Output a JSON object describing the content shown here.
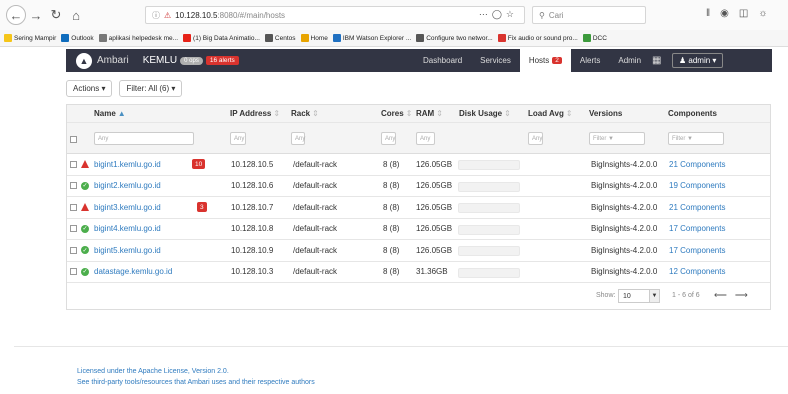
{
  "browser": {
    "url_host": "10.128.10.5",
    "url_path": ":8080/#/main/hosts",
    "search_placeholder": "Cari",
    "bookmarks": [
      {
        "label": "Sering Mampir",
        "color": "#f5c518"
      },
      {
        "label": "Outlook",
        "color": "#0f6cbd"
      },
      {
        "label": "aplikasi helpedesk me...",
        "color": "#777777"
      },
      {
        "label": "(1) Big Data Animatio...",
        "color": "#e62117"
      },
      {
        "label": "Centos",
        "color": "#555555"
      },
      {
        "label": "Home",
        "color": "#e8a400"
      },
      {
        "label": "IBM Watson Explorer ...",
        "color": "#1f70c1"
      },
      {
        "label": "Configure two networ...",
        "color": "#555555"
      },
      {
        "label": "Fix audio or sound pro...",
        "color": "#d9332e"
      },
      {
        "label": "DCC",
        "color": "#3c9a3c"
      }
    ]
  },
  "nav": {
    "brand": "Ambari",
    "cluster": "KEMLU",
    "ops_badge": "0 ops",
    "alerts_badge": "16 alerts",
    "tabs": [
      {
        "label": "Dashboard",
        "active": false
      },
      {
        "label": "Services",
        "active": false
      },
      {
        "label": "Hosts",
        "active": true,
        "count": "2"
      },
      {
        "label": "Alerts",
        "active": false
      },
      {
        "label": "Admin",
        "active": false
      }
    ],
    "user_label": "admin"
  },
  "toolbar": {
    "actions_label": "Actions",
    "filter_label": "Filter: All (6)"
  },
  "table": {
    "columns": [
      "Name",
      "IP Address",
      "Rack",
      "Cores",
      "RAM",
      "Disk Usage",
      "Load Avg",
      "Versions",
      "Components"
    ],
    "filter_placeholder_any": "Any",
    "filter_placeholder_filter": "Filter",
    "rows": [
      {
        "name": "bigint1.kemlu.go.id",
        "status": "critical",
        "alerts": "10",
        "ip": "10.128.10.5",
        "rack": "/default-rack",
        "cores": "8 (8)",
        "ram": "126.05GB",
        "version": "BigInsights-4.2.0.0",
        "components": "21 Components"
      },
      {
        "name": "bigint2.kemlu.go.id",
        "status": "ok",
        "alerts": "",
        "ip": "10.128.10.6",
        "rack": "/default-rack",
        "cores": "8 (8)",
        "ram": "126.05GB",
        "version": "BigInsights-4.2.0.0",
        "components": "19 Components"
      },
      {
        "name": "bigint3.kemlu.go.id",
        "status": "critical",
        "alerts": "3",
        "ip": "10.128.10.7",
        "rack": "/default-rack",
        "cores": "8 (8)",
        "ram": "126.05GB",
        "version": "BigInsights-4.2.0.0",
        "components": "21 Components"
      },
      {
        "name": "bigint4.kemlu.go.id",
        "status": "ok",
        "alerts": "",
        "ip": "10.128.10.8",
        "rack": "/default-rack",
        "cores": "8 (8)",
        "ram": "126.05GB",
        "version": "BigInsights-4.2.0.0",
        "components": "17 Components"
      },
      {
        "name": "bigint5.kemlu.go.id",
        "status": "ok",
        "alerts": "",
        "ip": "10.128.10.9",
        "rack": "/default-rack",
        "cores": "8 (8)",
        "ram": "126.05GB",
        "version": "BigInsights-4.2.0.0",
        "components": "17 Components"
      },
      {
        "name": "datastage.kemlu.go.id",
        "status": "ok",
        "alerts": "",
        "ip": "10.128.10.3",
        "rack": "/default-rack",
        "cores": "8 (8)",
        "ram": "31.36GB",
        "version": "BigInsights-4.2.0.0",
        "components": "12 Components"
      }
    ]
  },
  "pager": {
    "show_label": "Show:",
    "page_size": "10",
    "range": "1 - 6 of 6"
  },
  "footer": {
    "license": "Licensed under the Apache License, Version 2.0.",
    "thirdparty": "See third-party tools/resources that Ambari uses and their respective authors"
  }
}
